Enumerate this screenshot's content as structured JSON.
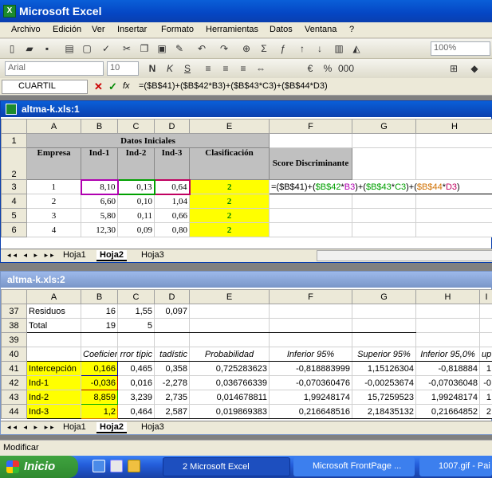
{
  "app": {
    "title": "Microsoft Excel"
  },
  "menu": [
    "Archivo",
    "Edición",
    "Ver",
    "Insertar",
    "Formato",
    "Herramientas",
    "Datos",
    "Ventana",
    "?"
  ],
  "toolbar": {
    "zoom": "100%",
    "font": "Arial",
    "font_size": "10"
  },
  "formula_bar": {
    "name_box": "CUARTIL",
    "cancel": "✕",
    "enter": "✓",
    "fx": "fx",
    "formula": "=($B$41)+($B$42*B3)+($B$43*C3)+($B$44*D3)"
  },
  "window1": {
    "title": "altma-k.xls:1",
    "columns": [
      "A",
      "B",
      "C",
      "D",
      "E",
      "F",
      "G",
      "H"
    ],
    "row_nums": [
      "1",
      "2",
      "3",
      "4",
      "5",
      "6"
    ],
    "merged_header": "Datos Iniciales",
    "headers": [
      "Empresa",
      "Ind-1",
      "Ind-2",
      "Ind-3",
      "Clasificación",
      "Score Discriminante"
    ],
    "rows": [
      {
        "empresa": "1",
        "ind1": "8,10",
        "ind2": "0,13",
        "ind3": "0,64",
        "clas": "2"
      },
      {
        "empresa": "2",
        "ind1": "6,60",
        "ind2": "0,10",
        "ind3": "1,04",
        "clas": "2"
      },
      {
        "empresa": "3",
        "ind1": "5,80",
        "ind2": "0,11",
        "ind3": "0,66",
        "clas": "2"
      },
      {
        "empresa": "4",
        "ind1": "12,30",
        "ind2": "0,09",
        "ind3": "0,80",
        "clas": "2"
      }
    ],
    "edit_formula": {
      "p1": "=($B$41)+(",
      "p2": "$B$42",
      "p3": "*",
      "p4": "B3",
      "p5": ")+(",
      "p6": "$B$43",
      "p7": "*",
      "p8": "C3",
      "p9": ")+(",
      "p10": "$B$44",
      "p11": "*",
      "p12": "D3",
      "p13": ")"
    },
    "tabs": [
      "Hoja1",
      "Hoja2",
      "Hoja3"
    ],
    "active_tab": "Hoja2"
  },
  "window2": {
    "title": "altma-k.xls:2",
    "columns": [
      "A",
      "B",
      "C",
      "D",
      "E",
      "F",
      "G",
      "H",
      "I"
    ],
    "rows": [
      {
        "n": "37",
        "a": "Residuos",
        "b": "16",
        "c": "1,55",
        "d": "0,097",
        "e": "",
        "f": "",
        "g": "",
        "h": "",
        "i": ""
      },
      {
        "n": "38",
        "a": "Total",
        "b": "19",
        "c": "5",
        "d": "",
        "e": "",
        "f": "",
        "g": "",
        "h": "",
        "i": ""
      },
      {
        "n": "39",
        "a": "",
        "b": "",
        "c": "",
        "d": "",
        "e": "",
        "f": "",
        "g": "",
        "h": "",
        "i": ""
      },
      {
        "n": "40",
        "a": "",
        "b": "Coeficient",
        "c": "rror típic",
        "d": "tadístic",
        "e": "Probabilidad",
        "f": "Inferior 95%",
        "g": "Superior 95%",
        "h": "Inferior 95,0%",
        "i": "up"
      },
      {
        "n": "41",
        "a": "Intercepción",
        "b": "0,166",
        "c": "0,465",
        "d": "0,358",
        "e": "0,725283623",
        "f": "-0,818883999",
        "g": "1,15126304",
        "h": "-0,818884",
        "i": "1"
      },
      {
        "n": "42",
        "a": "Ind-1",
        "b": "-0,036",
        "c": "0,016",
        "d": "-2,278",
        "e": "0,036766339",
        "f": "-0,070360476",
        "g": "-0,00253674",
        "h": "-0,07036048",
        "i": "-0"
      },
      {
        "n": "43",
        "a": "Ind-2",
        "b": "8,859",
        "c": "3,239",
        "d": "2,735",
        "e": "0,014678811",
        "f": "1,99248174",
        "g": "15,7259523",
        "h": "1,99248174",
        "i": "1"
      },
      {
        "n": "44",
        "a": "Ind-3",
        "b": "1,2",
        "c": "0,464",
        "d": "2,587",
        "e": "0,019869383",
        "f": "0,216648516",
        "g": "2,18435132",
        "h": "0,21664852",
        "i": "2"
      }
    ],
    "tabs": [
      "Hoja1",
      "Hoja2",
      "Hoja3"
    ],
    "active_tab": "Hoja2"
  },
  "status": "Modificar",
  "taskbar": {
    "start": "Inicio",
    "tasks": [
      "2 Microsoft Excel",
      "Microsoft FrontPage ...",
      "1007.gif - Pai"
    ]
  }
}
